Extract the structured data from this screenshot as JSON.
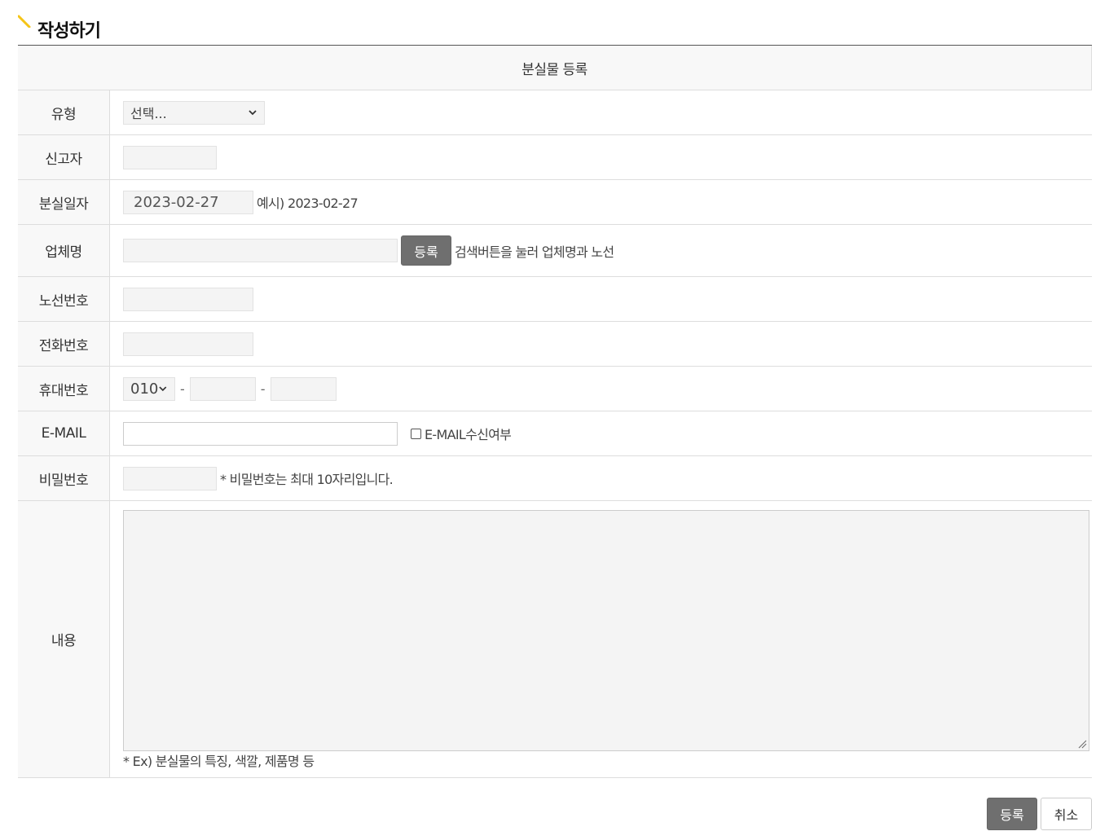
{
  "page": {
    "title": "작성하기"
  },
  "form": {
    "caption": "분실물 등록",
    "type": {
      "label": "유형",
      "selected": "선택..."
    },
    "reporter": {
      "label": "신고자",
      "value": ""
    },
    "lost_date": {
      "label": "분실일자",
      "value": "2023-02-27",
      "hint": "예시) 2023-02-27"
    },
    "company": {
      "label": "업체명",
      "value": "",
      "button": "등록",
      "hint": "검색버튼을 눌러 업체명과 노선"
    },
    "route": {
      "label": "노선번호",
      "value": ""
    },
    "phone": {
      "label": "전화번호",
      "value": ""
    },
    "mobile": {
      "label": "휴대번호",
      "prefix": "010",
      "dash": "-",
      "middle": "",
      "last": ""
    },
    "email": {
      "label": "E-MAIL",
      "value": "",
      "consent_label": "E-MAIL수신여부",
      "consent_checked": false
    },
    "password": {
      "label": "비밀번호",
      "value": "",
      "hint": "* 비밀번호는 최대 10자리입니다."
    },
    "content": {
      "label": "내용",
      "value": "",
      "note": "* Ex) 분실물의 특징, 색깔, 제품명 등"
    }
  },
  "footer": {
    "submit": "등록",
    "cancel": "취소"
  },
  "colors": {
    "accent": "#f5c518",
    "button_dark": "#6f6f6f",
    "header_bg": "#f8f8f8"
  }
}
